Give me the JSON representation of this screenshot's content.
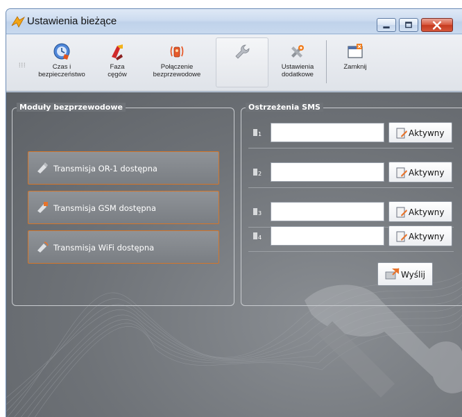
{
  "window": {
    "title": "Ustawienia bieżące",
    "minimize_icon": "minimize-icon",
    "maximize_icon": "maximize-icon",
    "close_icon": "close-icon"
  },
  "toolbar": {
    "items": [
      {
        "label": "Czas i\nbezpieczeństwo",
        "icon": "clock-shield-icon"
      },
      {
        "label": "Faza\ncęgów",
        "icon": "phase-clamp-icon"
      },
      {
        "label": "Połączenie\nbezprzewodowe",
        "icon": "wireless-icon"
      },
      {
        "label": "",
        "icon": "wrench-icon",
        "selected": true
      },
      {
        "label": "Ustawienia\ndodatkowe",
        "icon": "extra-settings-icon"
      },
      {
        "label": "Zamknij",
        "icon": "close-window-icon"
      }
    ]
  },
  "modules": {
    "legend": "Moduły bezprzewodowe",
    "buttons": [
      {
        "label": "Transmisja OR-1 dostępna",
        "icon": "or1-module-icon"
      },
      {
        "label": "Transmisja GSM dostępna",
        "icon": "gsm-module-icon"
      },
      {
        "label": "Transmisja WiFi dostępna",
        "icon": "wifi-module-icon"
      }
    ]
  },
  "sms": {
    "legend": "Ostrzeżenia SMS",
    "rows": [
      {
        "number": "1",
        "value": "",
        "button": "Aktywny"
      },
      {
        "number": "2",
        "value": "",
        "button": "Aktywny"
      },
      {
        "number": "3",
        "value": "",
        "button": "Aktywny"
      },
      {
        "number": "4",
        "value": "",
        "button": "Aktywny"
      }
    ],
    "send_label": "Wyślij"
  },
  "colors": {
    "accent_orange": "#d4762a",
    "panel_background": "#6e7277",
    "titlebar": "#c8d9ee"
  }
}
